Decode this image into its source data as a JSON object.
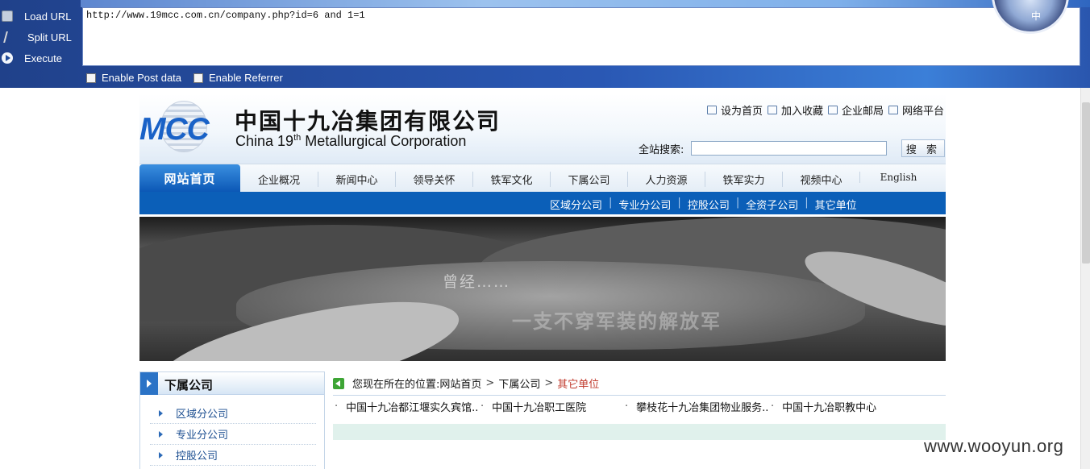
{
  "hackbar": {
    "load_url": "Load URL",
    "split_url": "Split URL",
    "execute": "Execute",
    "url_value": "http://www.19mcc.com.cn/company.php?id=6 and 1=1",
    "enable_post": "Enable Post data",
    "enable_referrer": "Enable Referrer",
    "avatar_text": "中"
  },
  "header": {
    "logo_text": "MCC",
    "company_cn": "中国十九冶集团有限公司",
    "company_en_pre": "China 19",
    "company_en_sup": "th",
    "company_en_post": " Metallurgical Corporation",
    "top_links": [
      "设为首页",
      "加入收藏",
      "企业邮局",
      "网络平台"
    ],
    "search_label": "全站搜索:",
    "search_value": "",
    "search_button": "搜 索"
  },
  "nav": {
    "home": "网站首页",
    "items": [
      "企业概况",
      "新闻中心",
      "领导关怀",
      "铁军文化",
      "下属公司",
      "人力资源",
      "铁军实力",
      "视频中心",
      "English"
    ]
  },
  "sub_nav": [
    "区域分公司",
    "专业分公司",
    "控股公司",
    "全资子公司",
    "其它单位"
  ],
  "banner": {
    "text1": "曾经……",
    "text2": "一支不穿军装的解放军"
  },
  "sidebar": {
    "title": "下属公司",
    "items": [
      "区域分公司",
      "专业分公司",
      "控股公司"
    ]
  },
  "breadcrumb": {
    "prefix": "您现在所在的位置:",
    "home": "网站首页",
    "parent": "下属公司",
    "current": "其它单位"
  },
  "entries": [
    "中国十九冶都江堰实久宾馆..",
    "中国十九冶职工医院",
    "攀枝花十九冶集团物业服务..",
    "中国十九冶职教中心"
  ],
  "watermark": "www.wooyun.org"
}
